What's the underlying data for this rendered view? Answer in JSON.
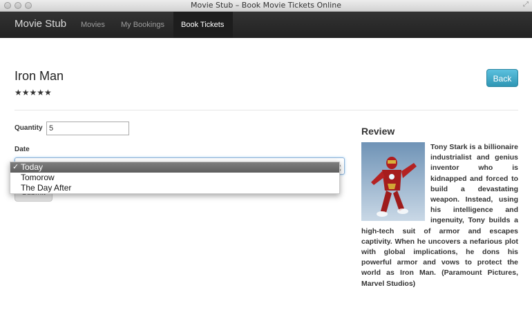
{
  "window": {
    "title": "Movie Stub – Book Movie Tickets Online"
  },
  "navbar": {
    "brand": "Movie Stub",
    "items": [
      {
        "label": "Movies",
        "active": false
      },
      {
        "label": "My Bookings",
        "active": false
      },
      {
        "label": "Book Tickets",
        "active": true
      }
    ]
  },
  "movie": {
    "title": "Iron Man",
    "rating": "★★★★★"
  },
  "back_label": "Back",
  "form": {
    "quantity_label": "Quantity",
    "quantity_value": "5",
    "date_label": "Date",
    "date_options": [
      "Today",
      "Tomorow",
      "The Day After"
    ],
    "selected_option": "Today",
    "submit_label": "Submit"
  },
  "review": {
    "heading": "Review",
    "text": "Tony Stark is a billionaire industrialist and genius inventor who is kidnapped and forced to build a devastating weapon. Instead, using his intelligence and ingenuity, Tony builds a high-tech suit of armor and escapes captivity. When he uncovers a nefarious plot with global implications, he dons his powerful armor and vows to protect the world as Iron Man. (Paramount Pictures, Marvel Studios)",
    "poster_icon": "iron-man-poster"
  },
  "colors": {
    "back_button": "#5bc0de",
    "navbar": "#222222"
  }
}
